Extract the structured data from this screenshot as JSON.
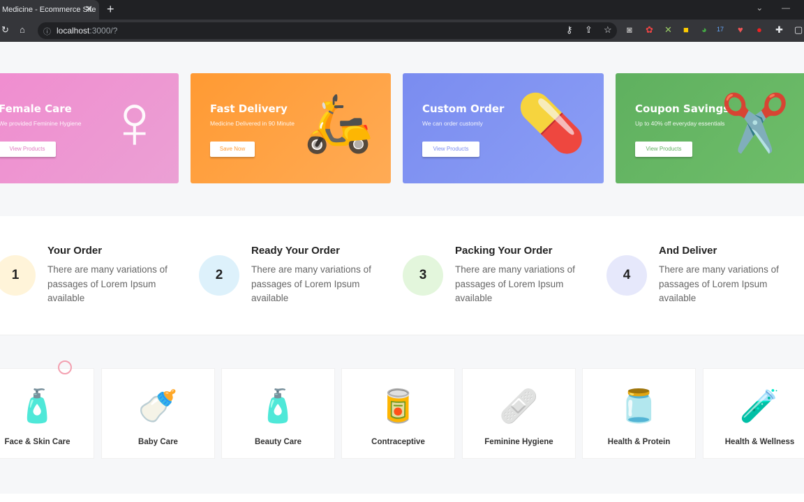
{
  "browser": {
    "tab_title": "Medicine - Ecommerce Site",
    "url_host": "localhost",
    "url_rest": ":3000/?"
  },
  "colors": {
    "female": "#ec8ccd",
    "delivery": "#ff9f40",
    "custom": "#7b8ff0",
    "coupon": "#66b566"
  },
  "banners": [
    {
      "title": "Female Care",
      "subtitle": "We provided Feminine Hygiene",
      "button": "View Products",
      "icon": "female-symbol-icon"
    },
    {
      "title": "Fast Delivery",
      "subtitle": "Medicine Delivered in 90 Minute",
      "button": "Save Now",
      "icon": "scooter-delivery-icon"
    },
    {
      "title": "Custom Order",
      "subtitle": "We can order customly",
      "button": "View Products",
      "icon": "medicine-box-icon"
    },
    {
      "title": "Coupon Savings",
      "subtitle": "Up to 40% off everyday essentials",
      "button": "View Products",
      "icon": "scissors-coupon-icon"
    }
  ],
  "steps": [
    {
      "num": "1",
      "title": "Your Order",
      "desc": "There are many variations of passages of Lorem Ipsum available"
    },
    {
      "num": "2",
      "title": "Ready Your Order",
      "desc": "There are many variations of passages of Lorem Ipsum available"
    },
    {
      "num": "3",
      "title": "Packing Your Order",
      "desc": "There are many variations of passages of Lorem Ipsum available"
    },
    {
      "num": "4",
      "title": "And Deliver",
      "desc": "There are many variations of passages of Lorem Ipsum available"
    }
  ],
  "categories": [
    {
      "label": "Face & Skin Care",
      "glyph": "🧴"
    },
    {
      "label": "Baby Care",
      "glyph": "🍼"
    },
    {
      "label": "Beauty Care",
      "glyph": "🧴"
    },
    {
      "label": "Contraceptive",
      "glyph": "🥫"
    },
    {
      "label": "Feminine Hygiene",
      "glyph": "🩹"
    },
    {
      "label": "Health & Protein",
      "glyph": "🫙"
    },
    {
      "label": "Health & Wellness",
      "glyph": "🧪"
    }
  ]
}
